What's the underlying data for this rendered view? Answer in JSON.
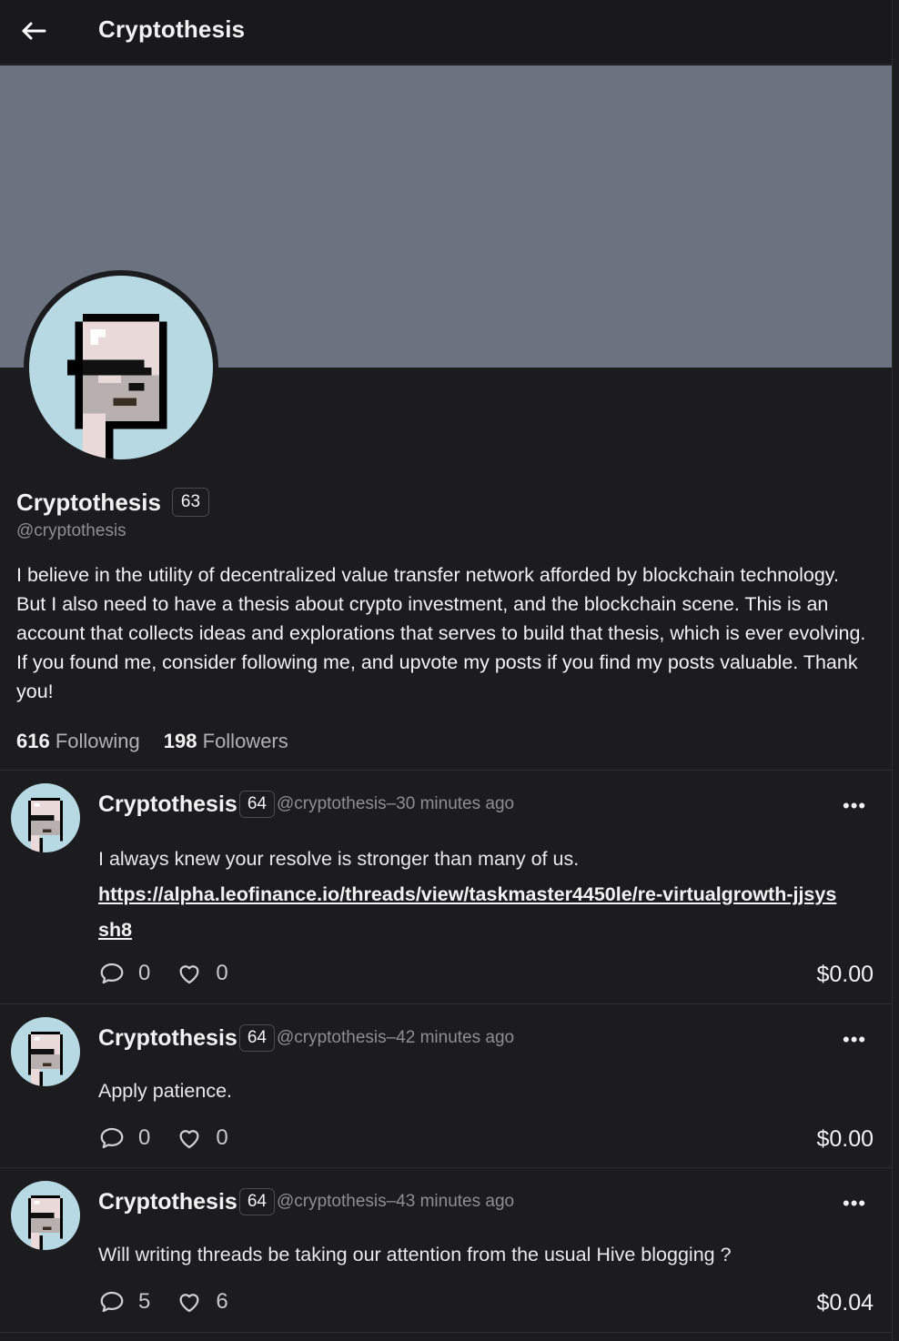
{
  "header": {
    "title": "Cryptothesis",
    "back_icon": "arrow-left-icon"
  },
  "banner": {
    "color": "#6b7280"
  },
  "profile": {
    "name": "Cryptothesis",
    "reputation": "63",
    "handle": "@cryptothesis",
    "bio": "I believe in the utility of decentralized value transfer network afforded by blockchain technology. But I also need to have a thesis about crypto investment, and the blockchain scene. This is an account that collects ideas and explorations that serves to build that thesis, which is ever evolving. If you found me, consider following me, and upvote my posts if you find my posts valuable. Thank you!",
    "following_count": "616",
    "following_label": "Following",
    "followers_count": "198",
    "followers_label": "Followers"
  },
  "posts": [
    {
      "author": "Cryptothesis",
      "reputation": "64",
      "meta": "@cryptothesis–30 minutes ago",
      "text": "I always knew your resolve is stronger than many of us.",
      "link": "https://alpha.leofinance.io/threads/view/taskmaster4450le/re-virtualgrowth-jjsyssh8",
      "comments": "0",
      "likes": "0",
      "payout": "$0.00"
    },
    {
      "author": "Cryptothesis",
      "reputation": "64",
      "meta": "@cryptothesis–42 minutes ago",
      "text": "Apply patience.",
      "comments": "0",
      "likes": "0",
      "payout": "$0.00"
    },
    {
      "author": "Cryptothesis",
      "reputation": "64",
      "meta": "@cryptothesis–43 minutes ago",
      "text": "Will writing threads be taking our attention from the usual Hive blogging ?",
      "comments": "5",
      "likes": "6",
      "payout": "$0.04"
    }
  ],
  "icons": {
    "more": "more-horizontal-icon",
    "comment": "comment-icon",
    "like": "heart-icon"
  },
  "more_glyph": "•••"
}
